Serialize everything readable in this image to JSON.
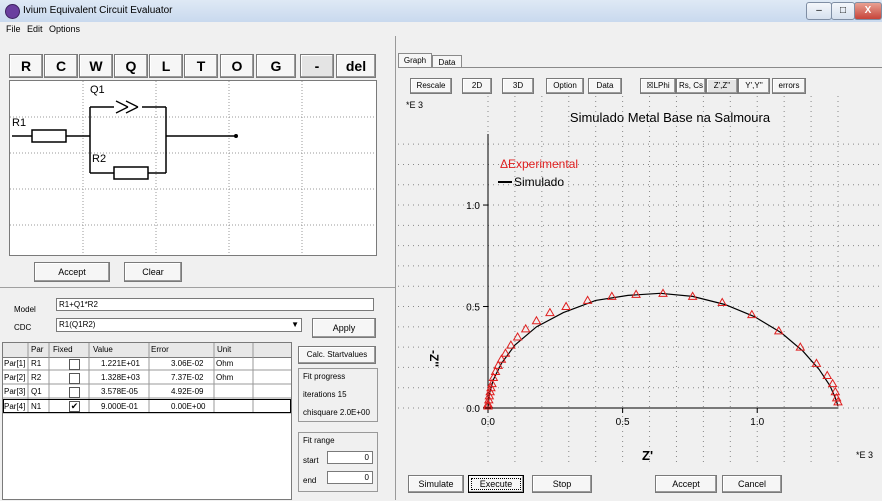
{
  "window": {
    "title": "Ivium Equivalent Circuit Evaluator",
    "min": "–",
    "max": "□",
    "close": "X"
  },
  "menu": [
    "File",
    "Edit",
    "Options"
  ],
  "components": [
    "R",
    "C",
    "W",
    "Q",
    "L",
    "T",
    "O",
    "G",
    "-",
    "del"
  ],
  "circuit": {
    "r1": "R1",
    "q1": "Q1",
    "r2": "R2"
  },
  "accept_label": "Accept",
  "clear_label": "Clear",
  "model": {
    "label": "Model",
    "value": "R1+Q1*R2"
  },
  "cdc": {
    "label": "CDC",
    "value": "R1(Q1R2)"
  },
  "apply_label": "Apply",
  "table": {
    "headers": [
      "",
      "Par",
      "Fixed",
      "Value",
      "Error",
      "Unit"
    ],
    "rows": [
      {
        "id": "Par[1]",
        "par": "R1",
        "fixed": false,
        "value": "1.221E+01",
        "error": "3.06E-02",
        "unit": "Ohm"
      },
      {
        "id": "Par[2]",
        "par": "R2",
        "fixed": false,
        "value": "1.328E+03",
        "error": "7.37E-02",
        "unit": "Ohm"
      },
      {
        "id": "Par[3]",
        "par": "Q1",
        "fixed": false,
        "value": "3.578E-05",
        "error": "4.92E-09",
        "unit": ""
      },
      {
        "id": "Par[4]",
        "par": "N1",
        "fixed": true,
        "value": "9.000E-01",
        "error": "0.00E+00",
        "unit": ""
      }
    ]
  },
  "calc_label": "Calc. Startvalues",
  "fit": {
    "progress_label": "Fit progress",
    "iterations": "iterations 15",
    "chisquare": "chisquare 2.0E+00"
  },
  "fit_range": {
    "label": "Fit range",
    "start_label": "start",
    "start": "0",
    "end_label": "end",
    "end": "0"
  },
  "tabs": [
    "Graph",
    "Data"
  ],
  "graph_buttons": [
    "Rescale",
    "2D",
    "3D",
    "Option",
    "Data"
  ],
  "view_buttons": [
    "☒LPhi",
    "Rs, Cs",
    "Z',Z''",
    "Y',Y''",
    "errors"
  ],
  "bottom_buttons": [
    "Simulate",
    "Execute",
    "Stop",
    "Accept",
    "Cancel"
  ],
  "chart_data": {
    "type": "scatter",
    "title": "Simulado Metal Base na Salmoura",
    "xlabel": "Z'",
    "ylabel": "-Z''",
    "x_scale_label": "*E 3",
    "y_scale_label": "*E 3",
    "xlim": [
      0,
      1.3
    ],
    "ylim": [
      0,
      1.35
    ],
    "xticks": [
      "0.0",
      "0.5",
      "1.0"
    ],
    "yticks": [
      "0.0",
      "0.5",
      "1.0"
    ],
    "grid": true,
    "legend_placement": "top-left",
    "series": [
      {
        "name": "Experimental",
        "marker": "triangle",
        "color": "#e02020",
        "x": [
          0.0,
          0.0,
          0.003,
          0.005,
          0.008,
          0.011,
          0.015,
          0.02,
          0.028,
          0.038,
          0.05,
          0.065,
          0.085,
          0.11,
          0.14,
          0.18,
          0.23,
          0.29,
          0.37,
          0.46,
          0.55,
          0.65,
          0.76,
          0.87,
          0.98,
          1.08,
          1.16,
          1.22,
          1.26,
          1.28,
          1.29,
          1.295,
          1.3
        ],
        "y": [
          0.01,
          0.02,
          0.04,
          0.06,
          0.08,
          0.1,
          0.12,
          0.15,
          0.18,
          0.21,
          0.24,
          0.27,
          0.31,
          0.35,
          0.39,
          0.43,
          0.47,
          0.5,
          0.53,
          0.55,
          0.56,
          0.565,
          0.55,
          0.52,
          0.46,
          0.38,
          0.3,
          0.22,
          0.16,
          0.12,
          0.08,
          0.05,
          0.03
        ]
      },
      {
        "name": "Simulado",
        "line": true,
        "color": "#000000",
        "x": [
          0.0,
          0.005,
          0.02,
          0.05,
          0.1,
          0.18,
          0.28,
          0.4,
          0.52,
          0.64,
          0.76,
          0.88,
          0.99,
          1.09,
          1.17,
          1.23,
          1.27,
          1.29,
          1.3
        ],
        "y": [
          0.0,
          0.07,
          0.14,
          0.22,
          0.31,
          0.4,
          0.47,
          0.53,
          0.555,
          0.565,
          0.55,
          0.51,
          0.45,
          0.37,
          0.28,
          0.19,
          0.11,
          0.05,
          0.01
        ]
      }
    ]
  }
}
